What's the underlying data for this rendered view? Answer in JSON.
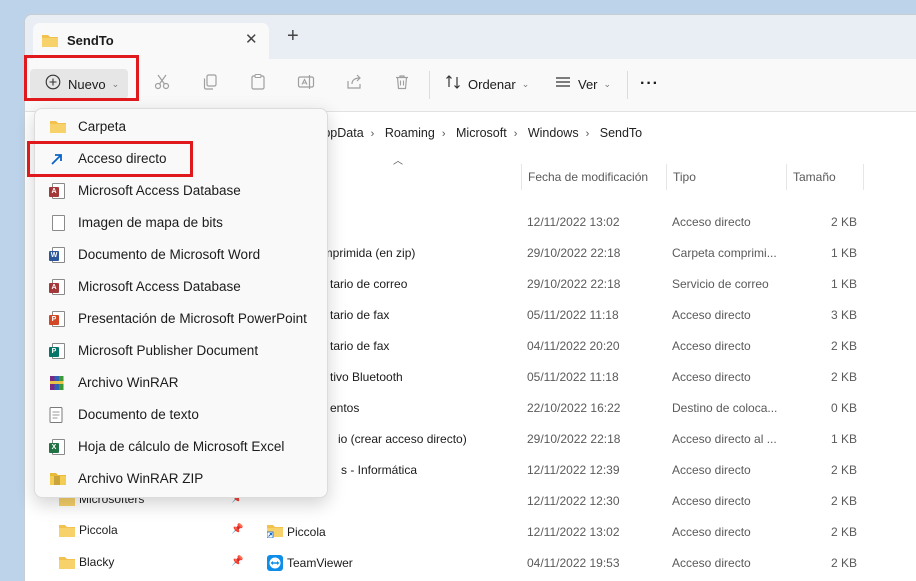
{
  "window": {
    "tab_title": "SendTo",
    "new_tab_symbol": "+",
    "close_symbol": "✕"
  },
  "toolbar": {
    "new_label": "Nuevo",
    "sort_label": "Ordenar",
    "view_label": "Ver",
    "more_label": "···"
  },
  "address": {
    "segments": [
      "AppData",
      "Roaming",
      "Microsoft",
      "Windows",
      "SendTo"
    ]
  },
  "columns": {
    "date": "Fecha de modificación",
    "type": "Tipo",
    "size": "Tamaño"
  },
  "files": [
    {
      "name": "",
      "date": "12/11/2022 13:02",
      "type": "Acceso directo",
      "size": "2 KB"
    },
    {
      "name": "comprimida (en zip)",
      "date": "29/10/2022 22:18",
      "type": "Carpeta comprimi...",
      "size": "1 KB"
    },
    {
      "name": "tario de correo",
      "date": "29/10/2022 22:18",
      "type": "Servicio de correo",
      "size": "1 KB"
    },
    {
      "name": "tario de fax",
      "date": "05/11/2022 11:18",
      "type": "Acceso directo",
      "size": "3 KB"
    },
    {
      "name": "tario de fax",
      "date": "04/11/2022 20:20",
      "type": "Acceso directo",
      "size": "2 KB"
    },
    {
      "name": "tivo Bluetooth",
      "date": "05/11/2022 11:18",
      "type": "Acceso directo",
      "size": "2 KB"
    },
    {
      "name": "entos",
      "date": "22/10/2022 16:22",
      "type": "Destino de coloca...",
      "size": "0 KB"
    },
    {
      "name": "io (crear acceso directo)",
      "date": "29/10/2022 22:18",
      "type": "Acceso directo al ...",
      "size": "1 KB"
    },
    {
      "name": "s - Informática",
      "date": "12/11/2022 12:39",
      "type": "Acceso directo",
      "size": "2 KB"
    },
    {
      "name": "",
      "date": "12/11/2022 12:30",
      "type": "Acceso directo",
      "size": "2 KB"
    },
    {
      "name": "Piccola",
      "date": "12/11/2022 13:02",
      "type": "Acceso directo",
      "size": "2 KB"
    },
    {
      "name": "TeamViewer",
      "date": "04/11/2022 19:53",
      "type": "Acceso directo",
      "size": "2 KB"
    }
  ],
  "nav": [
    {
      "label": "Microsofters"
    },
    {
      "label": "Piccola"
    },
    {
      "label": "Blacky"
    }
  ],
  "menu": {
    "items": [
      {
        "label": "Carpeta",
        "icon": "folder-icon"
      },
      {
        "label": "Acceso directo",
        "icon": "shortcut-icon"
      },
      {
        "label": "Microsoft Access Database",
        "icon": "access-icon"
      },
      {
        "label": "Imagen de mapa de bits",
        "icon": "bitmap-icon"
      },
      {
        "label": "Documento de Microsoft Word",
        "icon": "word-icon"
      },
      {
        "label": "Microsoft Access Database",
        "icon": "access-icon"
      },
      {
        "label": "Presentación de Microsoft PowerPoint",
        "icon": "powerpoint-icon"
      },
      {
        "label": "Microsoft Publisher Document",
        "icon": "publisher-icon"
      },
      {
        "label": "Archivo WinRAR",
        "icon": "winrar-icon"
      },
      {
        "label": "Documento de texto",
        "icon": "text-document-icon"
      },
      {
        "label": "Hoja de cálculo de Microsoft Excel",
        "icon": "excel-icon"
      },
      {
        "label": "Archivo WinRAR ZIP",
        "icon": "winrar-zip-icon"
      }
    ]
  },
  "colors": {
    "highlight": "#e0191d",
    "folder": "#f2c14e",
    "accent": "#0a64c8"
  }
}
